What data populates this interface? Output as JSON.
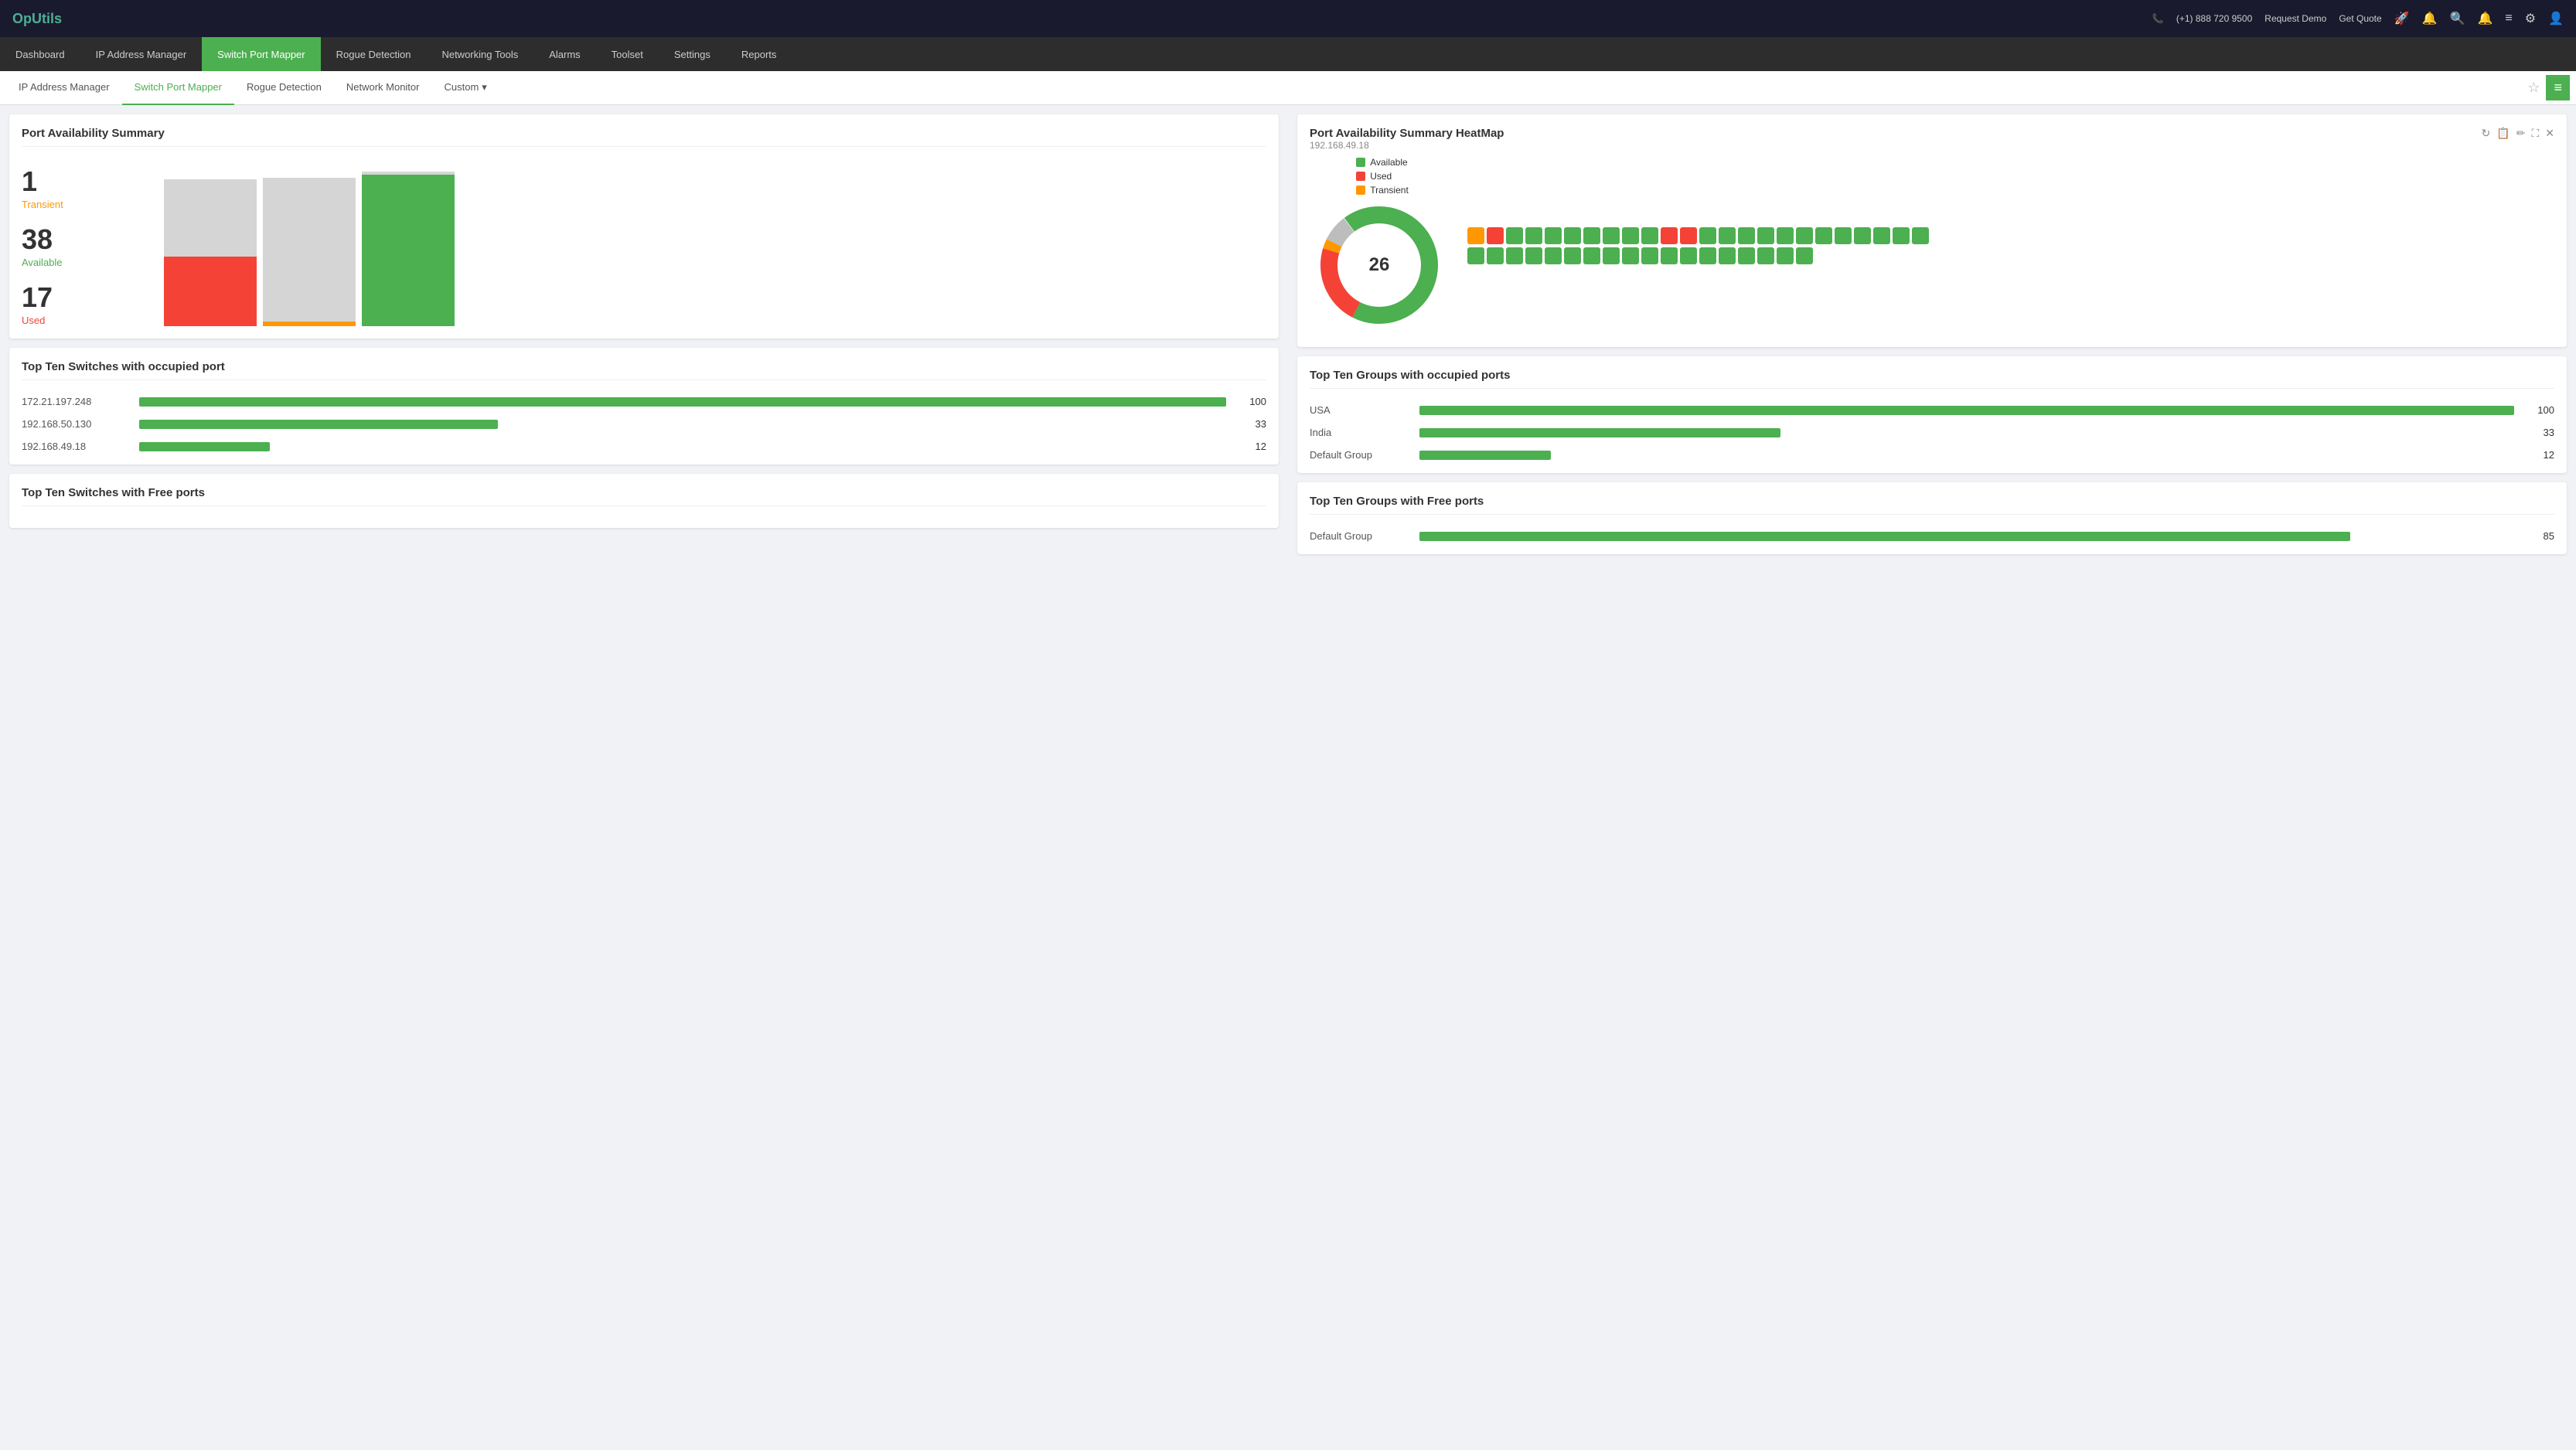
{
  "app": {
    "logo": "OpUtils",
    "phone": "(+1) 888 720 9500",
    "request_demo": "Request Demo",
    "get_quote": "Get Quote"
  },
  "main_nav": {
    "items": [
      {
        "label": "Dashboard",
        "active": false
      },
      {
        "label": "IP Address Manager",
        "active": false
      },
      {
        "label": "Switch Port Mapper",
        "active": true
      },
      {
        "label": "Rogue Detection",
        "active": false
      },
      {
        "label": "Networking Tools",
        "active": false
      },
      {
        "label": "Alarms",
        "active": false
      },
      {
        "label": "Toolset",
        "active": false
      },
      {
        "label": "Settings",
        "active": false
      },
      {
        "label": "Reports",
        "active": false
      }
    ]
  },
  "sub_nav": {
    "items": [
      {
        "label": "IP Address Manager",
        "active": false
      },
      {
        "label": "Switch Port Mapper",
        "active": true
      },
      {
        "label": "Rogue Detection",
        "active": false
      },
      {
        "label": "Network Monitor",
        "active": false
      },
      {
        "label": "Custom",
        "active": false,
        "dropdown": true
      }
    ]
  },
  "port_summary": {
    "card_title": "Port Availability Summary",
    "transient_count": "1",
    "transient_label": "Transient",
    "available_count": "38",
    "available_label": "Available",
    "used_count": "17",
    "used_label": "Used"
  },
  "heatmap": {
    "title": "Port Availability Summary HeatMap",
    "subtitle": "192.168.49.18",
    "center_value": "26",
    "legend": [
      {
        "label": "Available",
        "color": "#4caf50"
      },
      {
        "label": "Used",
        "color": "#f44336"
      },
      {
        "label": "Transient",
        "color": "#ff9800"
      }
    ],
    "grid_row1": [
      "orange",
      "red",
      "green",
      "green",
      "green",
      "green",
      "green",
      "green",
      "green",
      "green",
      "red",
      "red",
      "green",
      "green",
      "green",
      "green",
      "green",
      "green",
      "green",
      "green",
      "green",
      "green",
      "green",
      "green"
    ],
    "grid_row2": [
      "green",
      "green",
      "green",
      "green",
      "green",
      "green",
      "green",
      "green",
      "green",
      "green",
      "green",
      "green",
      "green",
      "green",
      "green",
      "green",
      "green",
      "green"
    ]
  },
  "top_switches_occupied": {
    "title": "Top Ten Switches with occupied port",
    "items": [
      {
        "ip": "172.21.197.248",
        "value": 100,
        "max": 100
      },
      {
        "ip": "192.168.50.130",
        "value": 33,
        "max": 100
      },
      {
        "ip": "192.168.49.18",
        "value": 12,
        "max": 100
      }
    ]
  },
  "top_switches_free": {
    "title": "Top Ten Switches with Free ports"
  },
  "top_groups_occupied": {
    "title": "Top Ten Groups with occupied ports",
    "items": [
      {
        "name": "USA",
        "value": 100,
        "max": 100
      },
      {
        "name": "India",
        "value": 33,
        "max": 100
      },
      {
        "name": "Default Group",
        "value": 12,
        "max": 100
      }
    ]
  },
  "top_groups_free": {
    "title": "Top Ten Groups with Free ports",
    "items": [
      {
        "name": "Default Group",
        "value": 85,
        "max": 100
      }
    ]
  }
}
